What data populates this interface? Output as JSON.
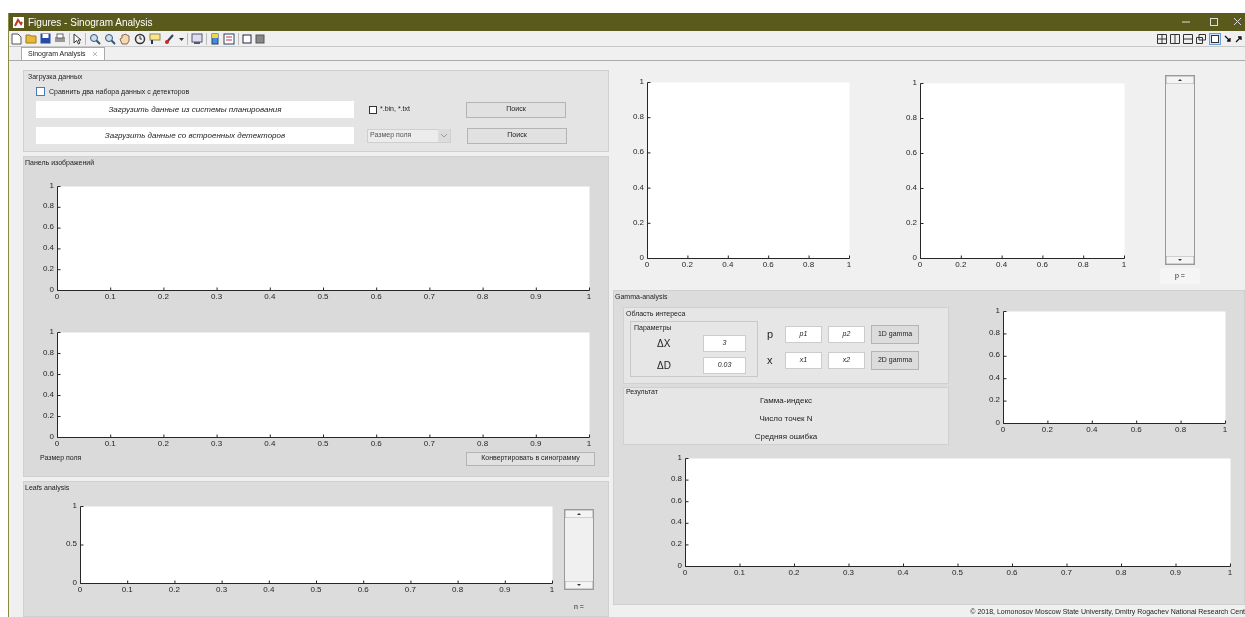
{
  "window": {
    "title": "Figures - Sinogram Analysis"
  },
  "tabs": [
    {
      "label": "Sinogram Analysis",
      "selected": true
    }
  ],
  "data_loading": {
    "title": "Загрузка данных",
    "compare_checkbox": {
      "label": "Сравнить два набора данных с детекторов",
      "checked": false
    },
    "planning_label": "Загрузить данные из системы планирования",
    "bin_checkbox": {
      "label": "*.bin, *.txt",
      "checked": false
    },
    "detectors_label": "Загрузить данные со встроенных детекторов",
    "field_size_dropdown": {
      "value": "Размер поля",
      "disabled": true
    },
    "search_buttons": [
      "Поиск",
      "Поиск"
    ]
  },
  "image_panel": {
    "title": "Панель изображений",
    "axes": [
      {
        "yticks": [
          "1",
          "0.8",
          "0.6",
          "0.4",
          "0.2",
          "0"
        ],
        "xticks": [
          "0",
          "0.1",
          "0.2",
          "0.3",
          "0.4",
          "0.5",
          "0.6",
          "0.7",
          "0.8",
          "0.9",
          "1"
        ]
      },
      {
        "yticks": [
          "1",
          "0.8",
          "0.6",
          "0.4",
          "0.2",
          "0"
        ],
        "xticks": [
          "0",
          "0.1",
          "0.2",
          "0.3",
          "0.4",
          "0.5",
          "0.6",
          "0.7",
          "0.8",
          "0.9",
          "1"
        ]
      }
    ],
    "field_size_label": "Размер поля",
    "convert_button": "Конвертировать в синограмму"
  },
  "leafs_panel": {
    "title": "Leafs analysis",
    "axes": {
      "yticks": [
        "1",
        "0.5",
        "0"
      ],
      "xticks": [
        "0",
        "0.1",
        "0.2",
        "0.3",
        "0.4",
        "0.5",
        "0.6",
        "0.7",
        "0.8",
        "0.9",
        "1"
      ]
    },
    "n_label": "n ="
  },
  "top_axes": [
    {
      "yticks": [
        "1",
        "0.8",
        "0.6",
        "0.4",
        "0.2",
        "0"
      ],
      "xticks": [
        "0",
        "0.2",
        "0.4",
        "0.6",
        "0.8",
        "1"
      ]
    },
    {
      "yticks": [
        "1",
        "0.8",
        "0.6",
        "0.4",
        "0.2",
        "0"
      ],
      "xticks": [
        "0",
        "0.2",
        "0.4",
        "0.6",
        "0.8",
        "1"
      ]
    }
  ],
  "p_label": "p =",
  "gamma": {
    "title": "Gamma-analysis",
    "roi": {
      "title": "Область интереса",
      "params": {
        "title": "Параметры",
        "rows": [
          {
            "label": "ΔX",
            "value": "3"
          },
          {
            "label": "ΔD",
            "value": "0.03"
          }
        ]
      },
      "p_label": "p",
      "p_fields": [
        "p1",
        "p2"
      ],
      "x_label": "x",
      "x_fields": [
        "x1",
        "x2"
      ],
      "buttons": [
        "1D gamma",
        "2D gamma"
      ]
    },
    "result": {
      "title": "Результат",
      "lines": [
        "Гамма-индекс",
        "Число точек N",
        "Средняя ошибка"
      ]
    },
    "axes": [
      {
        "yticks": [
          "1",
          "0.8",
          "0.6",
          "0.4",
          "0.2",
          "0"
        ],
        "xticks": [
          "0",
          "0.2",
          "0.4",
          "0.6",
          "0.8",
          "1"
        ]
      },
      {
        "yticks": [
          "1",
          "0.8",
          "0.6",
          "0.4",
          "0.2",
          "0"
        ],
        "xticks": [
          "0",
          "0.1",
          "0.2",
          "0.3",
          "0.4",
          "0.5",
          "0.6",
          "0.7",
          "0.8",
          "0.9",
          "1"
        ]
      }
    ]
  },
  "footer": "© 2018, Lomonosov Moscow State University, Dmitry Rogachev National Research Cent"
}
